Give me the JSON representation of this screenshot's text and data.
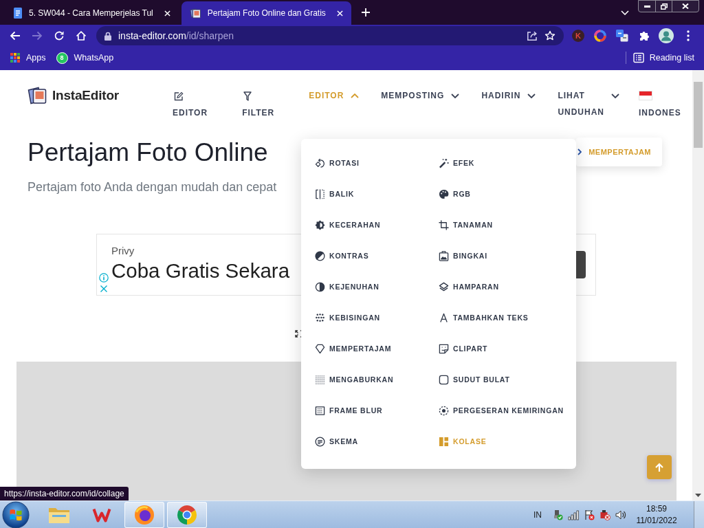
{
  "browser": {
    "tabs": [
      {
        "title": "5. SW044 - Cara Memperjelas Tul",
        "selected": false
      },
      {
        "title": "Pertajam Foto Online dan Gratis",
        "selected": true
      }
    ],
    "forward_disabled": true,
    "address": {
      "host": "insta-editor.com",
      "path": "/id/sharpen"
    },
    "extension_letter": "K",
    "bookmarks": [
      {
        "label": "Apps"
      },
      {
        "label": "WhatsApp",
        "badge": "8"
      }
    ],
    "reading_list": "Reading list",
    "status_url": "https://insta-editor.com/id/collage"
  },
  "site": {
    "logo": "InstaEditor",
    "nav": [
      {
        "label": "EDITOR",
        "kind": "stacked"
      },
      {
        "label": "FILTER",
        "kind": "stacked"
      },
      {
        "label": "EDITOR",
        "kind": "dropdown",
        "expanded": true
      },
      {
        "label": "MEMPOSTING",
        "kind": "dropdown",
        "expanded": false
      },
      {
        "label": "HADIRIN",
        "kind": "dropdown",
        "expanded": false
      },
      {
        "label": "LIHAT UNDUHAN",
        "kind": "dropdown",
        "expanded": false
      },
      {
        "label": "INDONES",
        "kind": "language"
      }
    ],
    "menu": [
      {
        "label": "ROTASI",
        "selected": false
      },
      {
        "label": "EFEK",
        "selected": false
      },
      {
        "label": "BALIK",
        "selected": false
      },
      {
        "label": "RGB",
        "selected": false
      },
      {
        "label": "KECERAHAN",
        "selected": false
      },
      {
        "label": "TANAMAN",
        "selected": false
      },
      {
        "label": "KONTRAS",
        "selected": false
      },
      {
        "label": "BINGKAI",
        "selected": false
      },
      {
        "label": "KEJENUHAN",
        "selected": false
      },
      {
        "label": "HAMPARAN",
        "selected": false
      },
      {
        "label": "KEBISINGAN",
        "selected": false
      },
      {
        "label": "TAMBAHKAN TEKS",
        "selected": false
      },
      {
        "label": "MEMPERTAJAM",
        "selected": false
      },
      {
        "label": "CLIPART",
        "selected": false
      },
      {
        "label": "MENGABURKAN",
        "selected": false
      },
      {
        "label": "SUDUT BULAT",
        "selected": false
      },
      {
        "label": "FRAME BLUR",
        "selected": false
      },
      {
        "label": "PERGESERAN KEMIRINGAN",
        "selected": false
      },
      {
        "label": "SKEMA",
        "selected": false
      },
      {
        "label": "KOLASE",
        "selected": true
      }
    ],
    "breadcrumb": "MEMPERTAJAM",
    "title": "Pertajam Foto Online",
    "subtitle": "Pertajam foto Anda dengan mudah dan cepat",
    "ad": {
      "advertiser": "Privy",
      "headline": "Coba Gratis Sekara"
    }
  },
  "taskbar": {
    "apps": [
      {
        "running": false
      },
      {
        "running": false
      },
      {
        "running": true
      },
      {
        "running": true
      }
    ],
    "language": "IN",
    "time": "18:59",
    "date": "11/01/2022"
  }
}
